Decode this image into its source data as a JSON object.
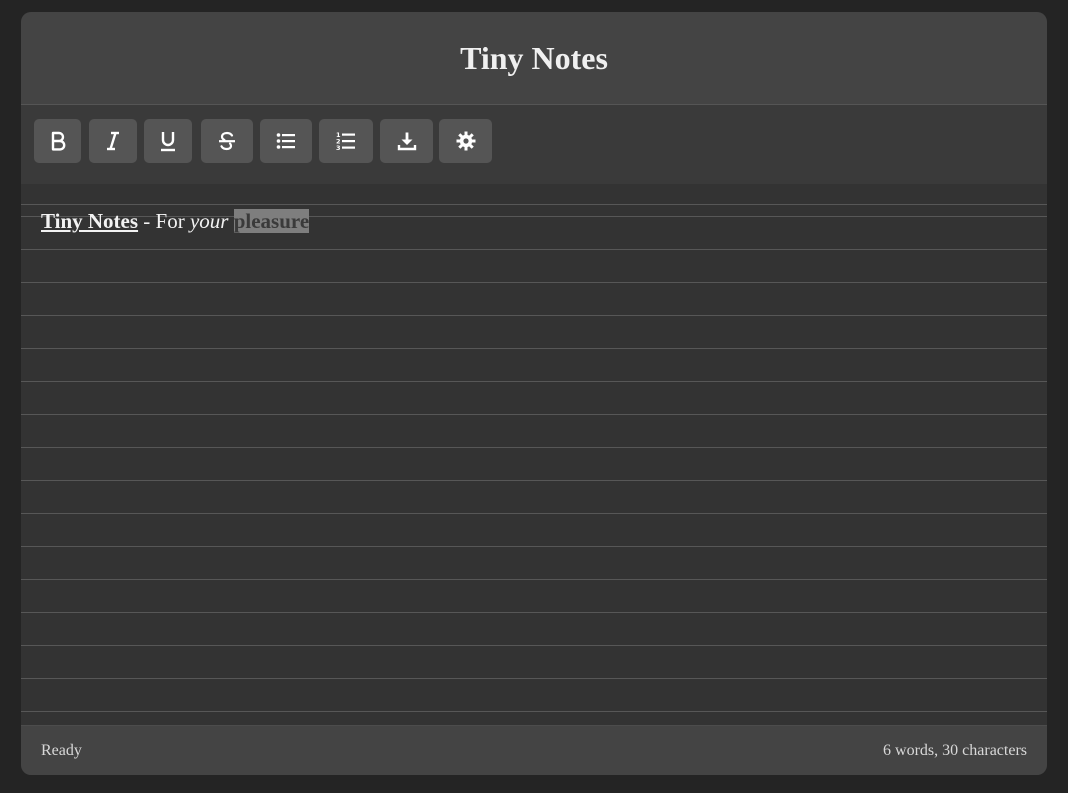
{
  "app": {
    "title": "Tiny Notes"
  },
  "toolbar": {
    "buttons": [
      {
        "name": "bold",
        "icon": "bold-icon"
      },
      {
        "name": "italic",
        "icon": "italic-icon"
      },
      {
        "name": "underline",
        "icon": "underline-icon"
      },
      {
        "name": "strikethrough",
        "icon": "strikethrough-icon"
      },
      {
        "name": "bullet-list",
        "icon": "bullet-list-icon"
      },
      {
        "name": "numbered-list",
        "icon": "numbered-list-icon"
      },
      {
        "name": "download",
        "icon": "download-icon"
      },
      {
        "name": "settings",
        "icon": "gear-icon"
      }
    ]
  },
  "editor": {
    "segments": {
      "title": "Tiny Notes",
      "dash_for": " - For ",
      "your": "your",
      "space": " ",
      "selected": "pleasure"
    }
  },
  "status": {
    "state": "Ready",
    "counts": "6 words, 30 characters"
  },
  "colors": {
    "background": "#242424",
    "panel": "#333333",
    "header": "#444444",
    "button": "#555555",
    "selection": "#7e7e7e",
    "text": "#f2f2f2"
  }
}
